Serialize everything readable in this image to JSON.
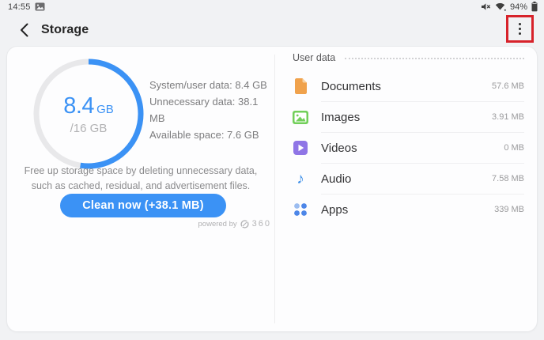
{
  "status_bar": {
    "time": "14:55",
    "battery_percent": "94%",
    "icons": [
      "screenshot-icon",
      "mute-icon",
      "wifi-icon",
      "battery-icon"
    ]
  },
  "header": {
    "title": "Storage",
    "back_icon": "back-chevron-icon",
    "menu_icon": "more-options-icon",
    "annotation_color": "#d7222a"
  },
  "storage_summary": {
    "used_value": "8.4",
    "used_unit": "GB",
    "total_label": "/16 GB",
    "used_gb": 8.4,
    "total_gb": 16,
    "accent_blue": "#3b92f5",
    "details": [
      "System/user data: 8.4 GB",
      "Unnecessary data: 38.1 MB",
      "Available space: 7.6 GB"
    ],
    "description": "Free up storage space by deleting unnecessary data, such as cached, residual, and advertisement files.",
    "clean_button_label": "Clean now (+38.1 MB)",
    "powered_by": "powered by",
    "powered_by_brand": "360"
  },
  "user_data": {
    "section_title": "User data",
    "items": [
      {
        "label": "Documents",
        "size": "57.6 MB",
        "icon": "document-icon",
        "color": "#f0a24c"
      },
      {
        "label": "Images",
        "size": "3.91 MB",
        "icon": "image-icon",
        "color": "#72cf5a"
      },
      {
        "label": "Videos",
        "size": "0 MB",
        "icon": "video-icon",
        "color": "#8f75e6"
      },
      {
        "label": "Audio",
        "size": "7.58 MB",
        "icon": "music-note-icon",
        "color": "#3d8fe8"
      },
      {
        "label": "Apps",
        "size": "339 MB",
        "icon": "apps-grid-icon",
        "color": "#4c86e8"
      }
    ]
  }
}
